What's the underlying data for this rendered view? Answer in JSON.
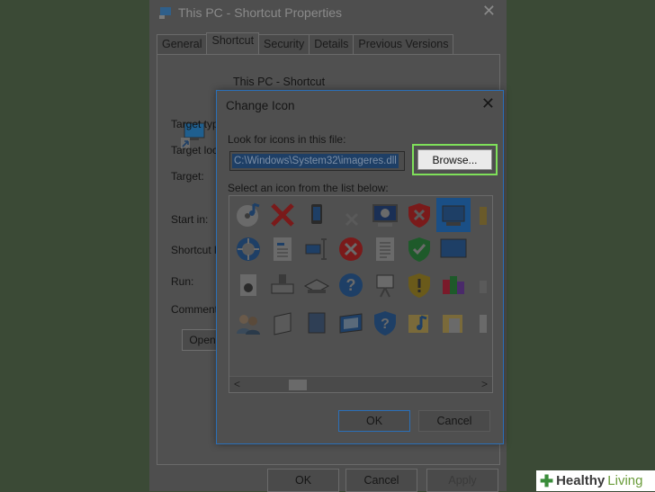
{
  "props": {
    "title": "This PC - Shortcut Properties",
    "close_glyph": "✕",
    "tabs": [
      {
        "label": "General"
      },
      {
        "label": "Shortcut"
      },
      {
        "label": "Security"
      },
      {
        "label": "Details"
      },
      {
        "label": "Previous Versions"
      }
    ],
    "shortcut_name": "This PC - Shortcut",
    "labels": {
      "target_type": "Target typ",
      "target_loc": "Target loc",
      "target": "Target:",
      "start_in": "Start in:",
      "shortcut_key": "Shortcut k",
      "run": "Run:",
      "comment": "Comment:"
    },
    "open_button": "Open",
    "ok": "OK",
    "cancel": "Cancel",
    "apply": "Apply"
  },
  "dialog": {
    "title": "Change Icon",
    "close_glyph": "✕",
    "look_label": "Look for icons in this file:",
    "path_value": "C:\\Windows\\System32\\imageres.dll",
    "browse": "Browse...",
    "list_label": "Select an icon from the list below:",
    "scroll_left": "<",
    "scroll_right": ">",
    "ok": "OK",
    "cancel": "Cancel",
    "icons": [
      [
        "cd-music-icon",
        "red-x-icon",
        "phone-icon",
        "gray-x-icon",
        "monitor-moon-icon",
        "shield-red-x-icon",
        "monitor-selected-icon"
      ],
      [
        "clock-disc-icon",
        "document-icon",
        "resize-icon",
        "red-circle-x-icon",
        "text-document-icon",
        "shield-check-icon",
        "blue-screen-icon"
      ],
      [
        "speaker-document-icon",
        "drive-icon",
        "scanner-icon",
        "question-circle-icon",
        "projector-icon",
        "shield-warning-icon",
        "programs-icon"
      ],
      [
        "users-icon",
        "server-icon",
        "panel-icon",
        "monitor-frame-icon",
        "shield-question-icon",
        "folder-music-icon",
        "folder-doc-icon"
      ]
    ]
  },
  "watermark": {
    "a": "Healthy",
    "b": "Living"
  }
}
